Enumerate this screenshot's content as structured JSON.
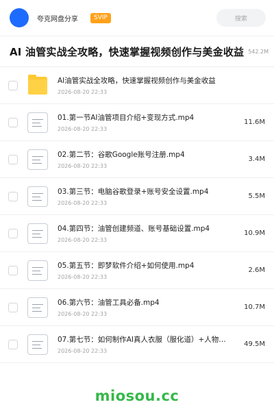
{
  "header": {
    "brand": "夸克网盘分享",
    "vip_badge": "SVIP",
    "search_placeholder": "搜索"
  },
  "page": {
    "title": "AI 油管实战全攻略，快速掌握视频创作与美金收益",
    "total_size": "542.2M"
  },
  "files": [
    {
      "name": "AI油管实战全攻略，快速掌握视频创作与美金收益",
      "date": "2026-08-20 22:33",
      "size": "",
      "icon": "folder-icon"
    },
    {
      "name": "01.第一节AI油管项目介绍+变现方式.mp4",
      "date": "2026-08-20 22:33",
      "size": "11.6M",
      "icon": "video-file-icon"
    },
    {
      "name": "02.第二节：谷歌Google账号注册.mp4",
      "date": "2026-08-20 22:33",
      "size": "3.4M",
      "icon": "video-file-icon"
    },
    {
      "name": "03.第三节：电脑谷歌登录+账号安全设置.mp4",
      "date": "2026-08-20 22:33",
      "size": "5.5M",
      "icon": "video-file-icon"
    },
    {
      "name": "04.第四节：油管创建频道、账号基础设置.mp4",
      "date": "2026-08-20 22:33",
      "size": "10.9M",
      "icon": "video-file-icon"
    },
    {
      "name": "05.第五节：即梦软件介绍+如何使用.mp4",
      "date": "2026-08-20 22:33",
      "size": "2.6M",
      "icon": "video-file-icon"
    },
    {
      "name": "06.第六节：油管工具必备.mp4",
      "date": "2026-08-20 22:33",
      "size": "10.7M",
      "icon": "video-file-icon"
    },
    {
      "name": "07.第七节：如何制作AI真人衣服（服化道）+人物…",
      "date": "2026-08-20 22:33",
      "size": "49.5M",
      "icon": "video-file-icon"
    }
  ],
  "watermark": "miosou.cc",
  "colors": {
    "accent": "#1e6bff",
    "vip": "#ffa11a",
    "folder": "#ffc933",
    "watermark": "#37b84a"
  }
}
